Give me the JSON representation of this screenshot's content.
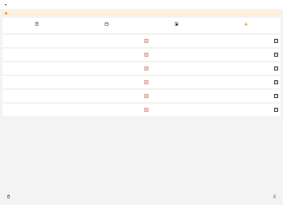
{
  "header": {
    "title": ""
  },
  "notice": {
    "text": "",
    "link": ""
  },
  "tabs": [
    {
      "label": "",
      "icon": "document-icon"
    },
    {
      "label": "",
      "icon": "calendar-icon"
    },
    {
      "label": "",
      "icon": "form-icon"
    },
    {
      "label": "",
      "icon": "alert-icon"
    }
  ],
  "rows": [
    {
      "left": {
        "name": "",
        "sub": ""
      },
      "right": {
        "name": "",
        "sub": ""
      }
    },
    {
      "left": {
        "name": "",
        "sub": ""
      },
      "right": {
        "name": "",
        "sub": ""
      }
    },
    {
      "left": {
        "name": "",
        "sub": ""
      },
      "right": {
        "name": "",
        "sub": ""
      }
    },
    {
      "left": {
        "name": "",
        "sub": ""
      },
      "right": {
        "name": "",
        "sub": ""
      }
    },
    {
      "left": {
        "name": "",
        "sub": ""
      },
      "right": {
        "name": "",
        "sub": ""
      }
    },
    {
      "left": {
        "name": "",
        "sub": ""
      },
      "right": {
        "name": "",
        "sub": ""
      }
    }
  ],
  "footer": {
    "left_label": "",
    "right_label": ""
  },
  "colors": {
    "accent": "#e08a1a",
    "notice_bg": "#fdf1dc",
    "icon_red": "#c0392b"
  }
}
